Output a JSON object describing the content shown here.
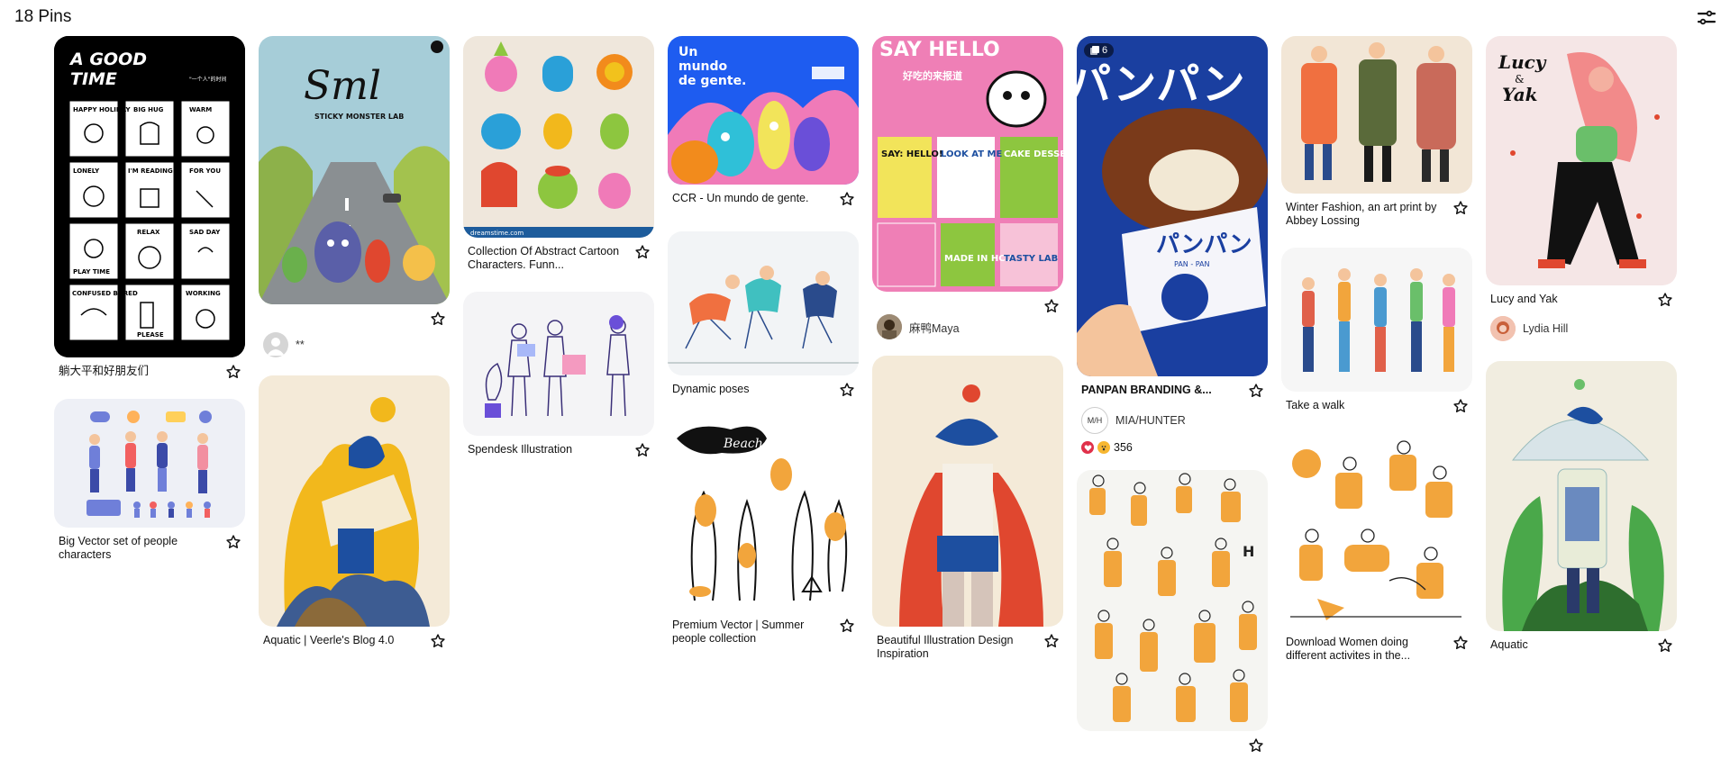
{
  "header": {
    "pins_count_label": "18 Pins",
    "filter_icon": "filter-sliders-icon"
  },
  "pins": {
    "aGoodTime": {
      "title": "躺大平和好朋友们",
      "thumb_text_1": "A GOOD",
      "thumb_text_2": "TIME",
      "thumb_text_3": "\"一个人\"的时间",
      "cells": [
        "HAPPY HOLIDAY",
        "BIG HUG",
        "WARM",
        "LONELY",
        "I'M READING",
        "FOR YOU",
        "PLAY TIME",
        "RELAX",
        "SAD DAY",
        "CONFUSED BORED",
        "PLEASE",
        "WORKING"
      ],
      "bg": "#000000"
    },
    "bigVector": {
      "title": "Big Vector set of people characters",
      "bg": "#eef0f6"
    },
    "sml": {
      "author": "**",
      "thumb_text_1": "Sml",
      "thumb_text_2": "STICKY MONSTER LAB",
      "bg": "#a6cdd8"
    },
    "aquaticVeerle": {
      "title": "Aquatic | Veerle's Blog 4.0",
      "bg": "#f4ead8"
    },
    "abstractChars": {
      "title": "Collection Of Abstract Cartoon Characters. Funn...",
      "footer_text": "dreamstime.com",
      "bg": "#efe7dc"
    },
    "spendesk": {
      "title": "Spendesk Illustration",
      "bg": "#f4f4f6"
    },
    "ccr": {
      "title": "CCR - Un mundo de gente.",
      "thumb_text_1": "Un",
      "thumb_text_2": "mundo",
      "thumb_text_3": "de gente.",
      "bg": "#1e5cf0"
    },
    "dynamicPoses": {
      "title": "Dynamic poses",
      "bg": "#f2f4f6"
    },
    "premiumVector": {
      "title": "Premium Vector | Summer people collection",
      "thumb_text_1": "Beach",
      "bg": "#ffffff"
    },
    "sayHello": {
      "author": "麻鸭Maya",
      "thumb_text_1": "SAY HELLO",
      "thumb_text_2": "好吃的来报道",
      "thumb_text_3": "SAY: HELLO!",
      "thumb_text_4": "LOOK AT ME",
      "thumb_text_5": "CAKE DESSERTS",
      "thumb_text_6": "MADE IN HCD",
      "thumb_text_7": "TASTY LAB",
      "bg": "#ef7fb6"
    },
    "beautifulIllus": {
      "title": "Beautiful Illustration Design Inspiration",
      "bg": "#f4ead8"
    },
    "panpan": {
      "title": "PANPAN BRANDING &...",
      "author": "MIA/HUNTER",
      "author_initials": "M/H",
      "reaction_count": "356",
      "badge_count": "6",
      "thumb_text_1": "パンパン",
      "thumb_text_2": "PAN - PAN",
      "bg": "#1a3fa0"
    },
    "crowd": {
      "bg": "#f5f5f2",
      "thumb_text_1": "H"
    },
    "winterFashion": {
      "title": "Winter Fashion, an art print by Abbey Lossing",
      "bg": "#f2e6d6"
    },
    "takeAWalk": {
      "title": "Take a walk",
      "bg": "#f6f6f6"
    },
    "downloadWomen": {
      "title": "Download Women doing different activites in the...",
      "bg": "#ffffff"
    },
    "lucyYak": {
      "title": "Lucy and Yak",
      "author": "Lydia Hill",
      "thumb_text_1": "Lucy",
      "thumb_text_2": "&",
      "thumb_text_3": "Yak",
      "bg": "#f5e6e6"
    },
    "aquatic": {
      "title": "Aquatic",
      "bg": "#f1ede0"
    }
  }
}
